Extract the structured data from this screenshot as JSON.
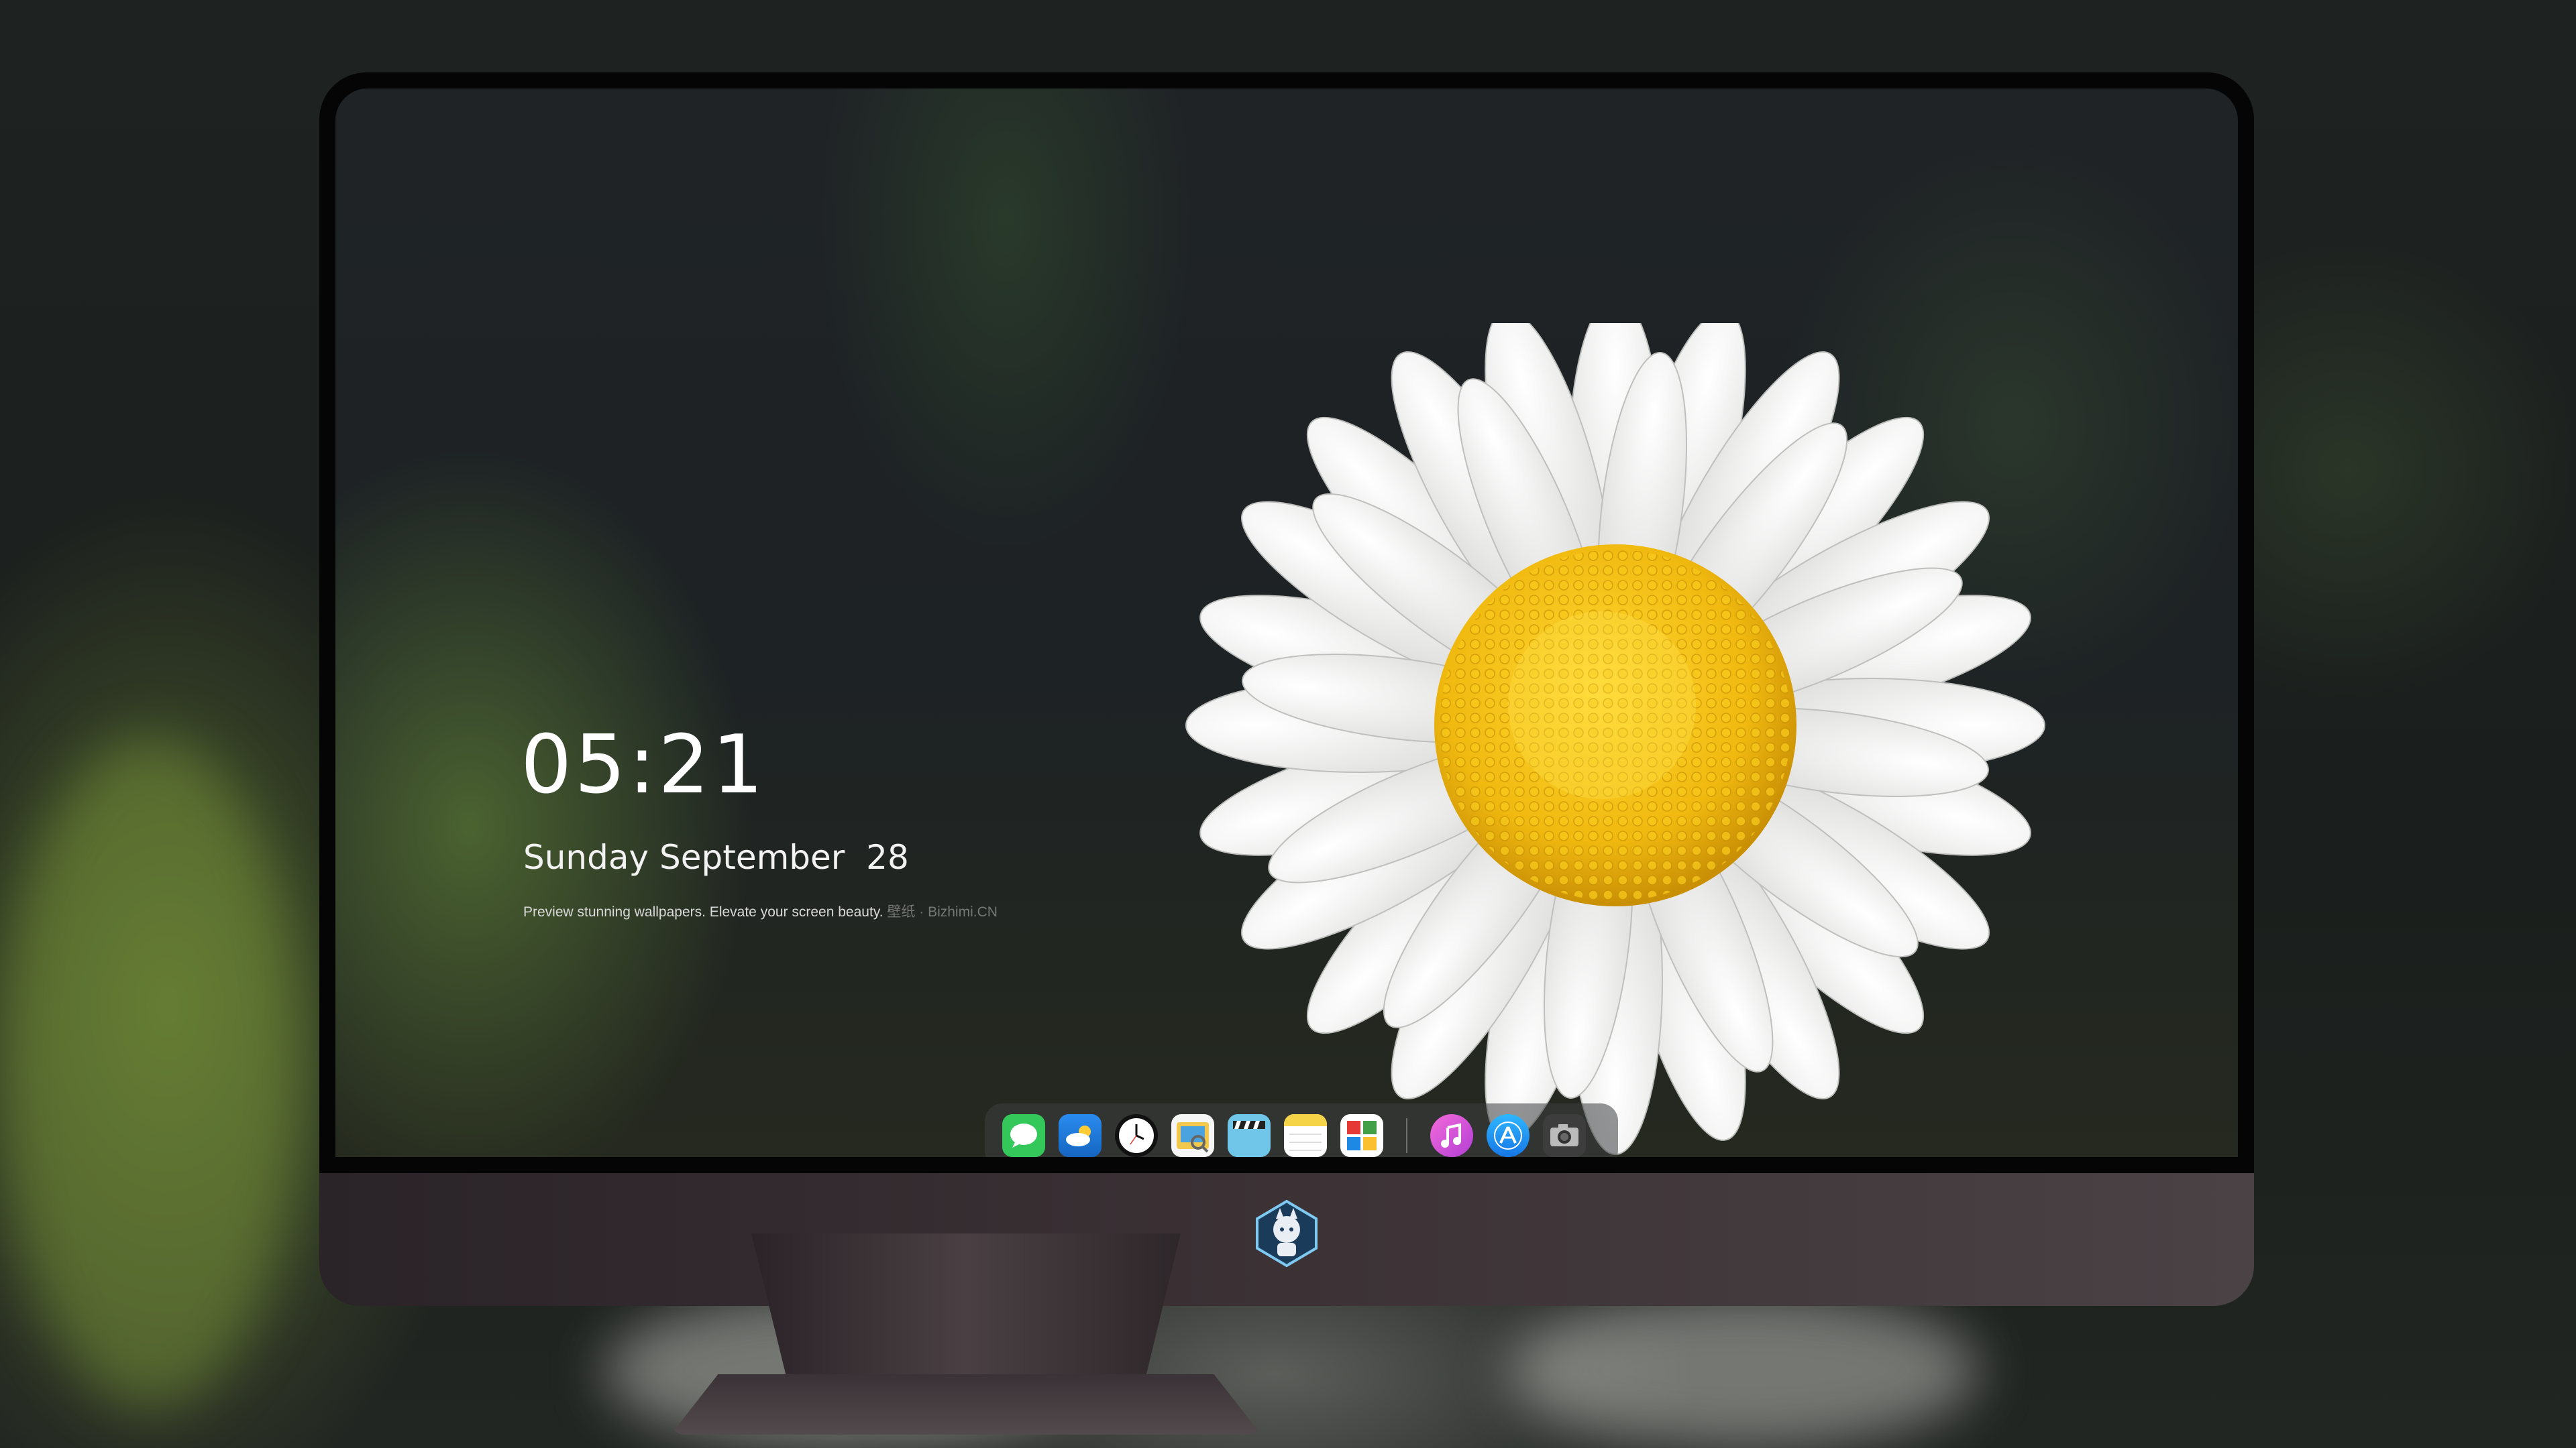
{
  "lock_screen": {
    "time": "05:21",
    "date": "Sunday September  28",
    "tagline": "Preview stunning wallpapers. Elevate your screen beauty.",
    "tagline_source": "壁纸 · Bizhimi.CN"
  },
  "dock": {
    "apps": [
      {
        "icon": "messages-icon",
        "color": "#34c759"
      },
      {
        "icon": "weather-icon",
        "color": "#1e88e5"
      },
      {
        "icon": "clock-icon",
        "color": "#111111"
      },
      {
        "icon": "preview-icon",
        "color": "#f2c94c"
      },
      {
        "icon": "clips-icon",
        "color": "#6fc6e8"
      },
      {
        "icon": "notes-icon",
        "color": "#f5d547"
      },
      {
        "icon": "photo-booth-icon",
        "color": "#ffffff"
      }
    ],
    "pinned": [
      {
        "icon": "itunes-icon",
        "color": "#d64bd9"
      },
      {
        "icon": "app-store-icon",
        "color": "#1a9bf0"
      },
      {
        "icon": "camera-icon",
        "color": "#555555"
      }
    ]
  },
  "colors": {
    "accent_yellow": "#f2c21b",
    "petal_white": "#f4f4f2",
    "bezel": "#050505",
    "chin": "#3c3236"
  }
}
